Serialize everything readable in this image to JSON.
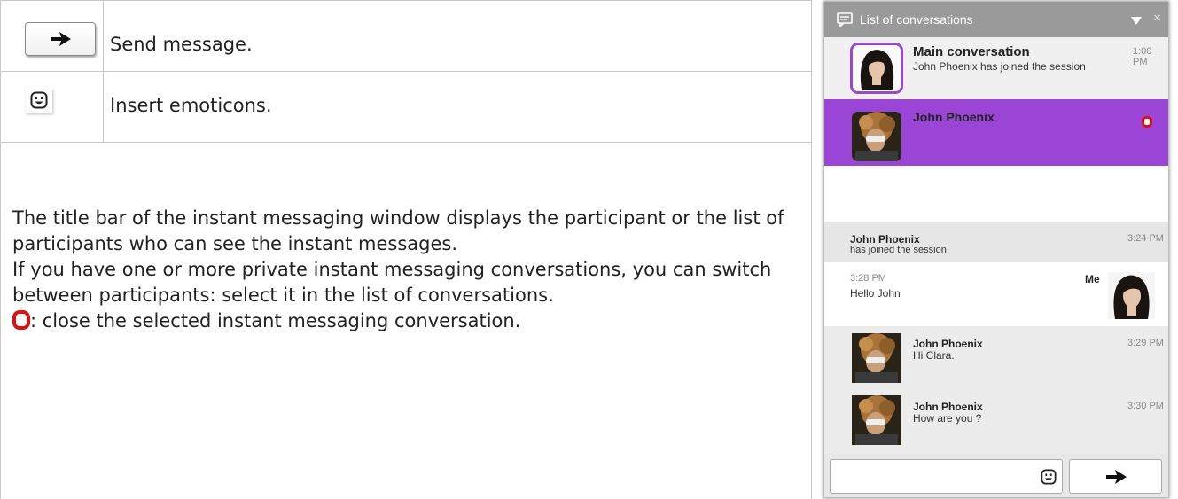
{
  "doc": {
    "rows": [
      {
        "icon": "send-arrow-icon",
        "text": "Send message."
      },
      {
        "icon": "emoticon-icon",
        "text": "Insert emoticons."
      }
    ],
    "paragraph": {
      "line1": "The title bar of the instant messaging window displays the participant or the list of participants who can see the instant messages.",
      "line2": "If you have one or more private instant messaging conversations, you can switch between participants: select it in the list of conversations.",
      "line3": ": close the selected instant messaging conversation."
    }
  },
  "im_window": {
    "title": "List of conversations",
    "conversations": [
      {
        "name": "Main conversation",
        "subtitle": "John Phoenix has joined the session",
        "time": "1:00 PM",
        "selected": false
      },
      {
        "name": "John Phoenix",
        "subtitle": "",
        "time": "",
        "selected": true
      }
    ],
    "messages": [
      {
        "name": "John Phoenix",
        "text": "has joined the session",
        "time": "3:24 PM"
      },
      {
        "name": "Me",
        "text": "Hello John",
        "time": "3:28 PM"
      },
      {
        "name": "John Phoenix",
        "text": "Hi Clara.",
        "time": "3:29 PM"
      },
      {
        "name": "John Phoenix",
        "text": "How are you ?",
        "time": "3:30 PM"
      }
    ],
    "colors": {
      "accent": "#9a45d6",
      "titlebar": "#9a9a9a",
      "close_red": "#cc0000"
    }
  }
}
